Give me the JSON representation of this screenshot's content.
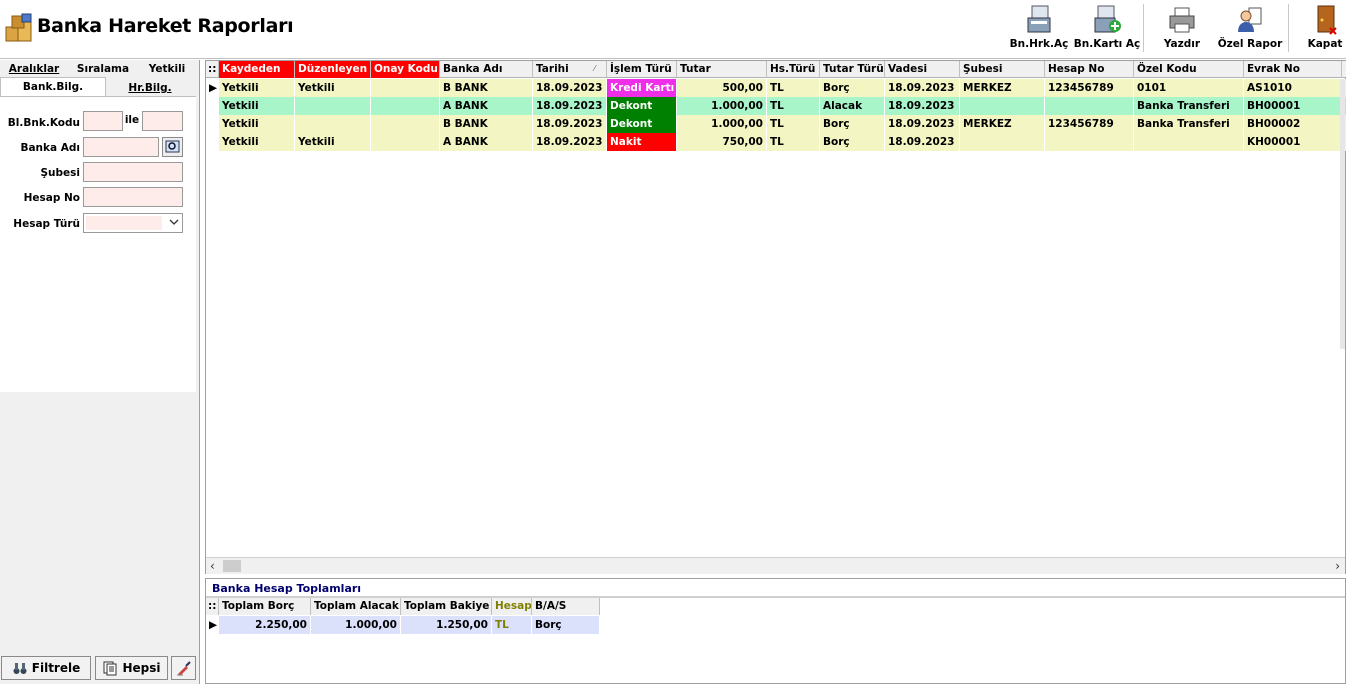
{
  "app": {
    "title": "Banka Hareket Raporları"
  },
  "toolbar": {
    "hrk_ac": "Bn.Hrk.Aç",
    "karti_ac": "Bn.Kartı Aç",
    "yazdir": "Yazdır",
    "ozel_rapor": "Özel Rapor",
    "kapat": "Kapat"
  },
  "left": {
    "tabs": [
      "Aralıklar",
      "Sıralama",
      "Yetkili"
    ],
    "subtabs": [
      "Bank.Bilg.",
      "Hr.Bilg."
    ],
    "fields": {
      "bl_bnk_kodu": "Bl.Bnk.Kodu",
      "ile": "ile",
      "banka_adi": "Banka Adı",
      "subesi": "Şubesi",
      "hesap_no": "Hesap No",
      "hesap_turu": "Hesap Türü"
    },
    "buttons": {
      "filtrele": "Filtrele",
      "hepsi": "Hepsi"
    }
  },
  "grid": {
    "columns": [
      "Kaydeden",
      "Düzenleyen",
      "Onay Kodu",
      "Banka Adı",
      "Tarihi",
      "İşlem Türü",
      "Tutar",
      "Hs.Türü",
      "Tutar Türü",
      "Vadesi",
      "Şubesi",
      "Hesap No",
      "Özel Kodu",
      "Evrak No"
    ],
    "rows": [
      {
        "kaydeden": "Yetkili",
        "duzenleyen": "Yetkili",
        "onay": "",
        "banka": "B BANK",
        "tarih": "18.09.2023",
        "islem": "Kredi Kartı",
        "tutar": "500,00",
        "hstur": "TL",
        "tutartur": "Borç",
        "vade": "18.09.2023",
        "sube": "MERKEZ",
        "hesapno": "123456789",
        "ozel": "0101",
        "evrak": "AS1010"
      },
      {
        "kaydeden": "Yetkili",
        "duzenleyen": "",
        "onay": "",
        "banka": "A BANK",
        "tarih": "18.09.2023",
        "islem": "Dekont",
        "tutar": "1.000,00",
        "hstur": "TL",
        "tutartur": "Alacak",
        "vade": "18.09.2023",
        "sube": "",
        "hesapno": "",
        "ozel": "Banka Transferi",
        "evrak": "BH00001"
      },
      {
        "kaydeden": "Yetkili",
        "duzenleyen": "",
        "onay": "",
        "banka": "B BANK",
        "tarih": "18.09.2023",
        "islem": "Dekont",
        "tutar": "1.000,00",
        "hstur": "TL",
        "tutartur": "Borç",
        "vade": "18.09.2023",
        "sube": "MERKEZ",
        "hesapno": "123456789",
        "ozel": "Banka Transferi",
        "evrak": "BH00002"
      },
      {
        "kaydeden": "Yetkili",
        "duzenleyen": "Yetkili",
        "onay": "",
        "banka": "A BANK",
        "tarih": "18.09.2023",
        "islem": "Nakit",
        "tutar": "750,00",
        "hstur": "TL",
        "tutartur": "Borç",
        "vade": "18.09.2023",
        "sube": "",
        "hesapno": "",
        "ozel": "",
        "evrak": "KH00001"
      }
    ]
  },
  "summary": {
    "title": "Banka Hesap Toplamları",
    "columns": [
      "Toplam Borç",
      "Toplam Alacak",
      "Toplam Bakiye",
      "Hesap",
      "B/A/S"
    ],
    "row": {
      "borc": "2.250,00",
      "alacak": "1.000,00",
      "bakiye": "1.250,00",
      "hesap": "TL",
      "bas": "Borç"
    }
  },
  "colors": {
    "row_yellow": "#f3f6c2",
    "row_green": "#a8f5c9",
    "kredi": "#ee2ee8",
    "dekont": "#008000",
    "nakit": "#ff0000",
    "summary_row": "#dbe0fb"
  }
}
